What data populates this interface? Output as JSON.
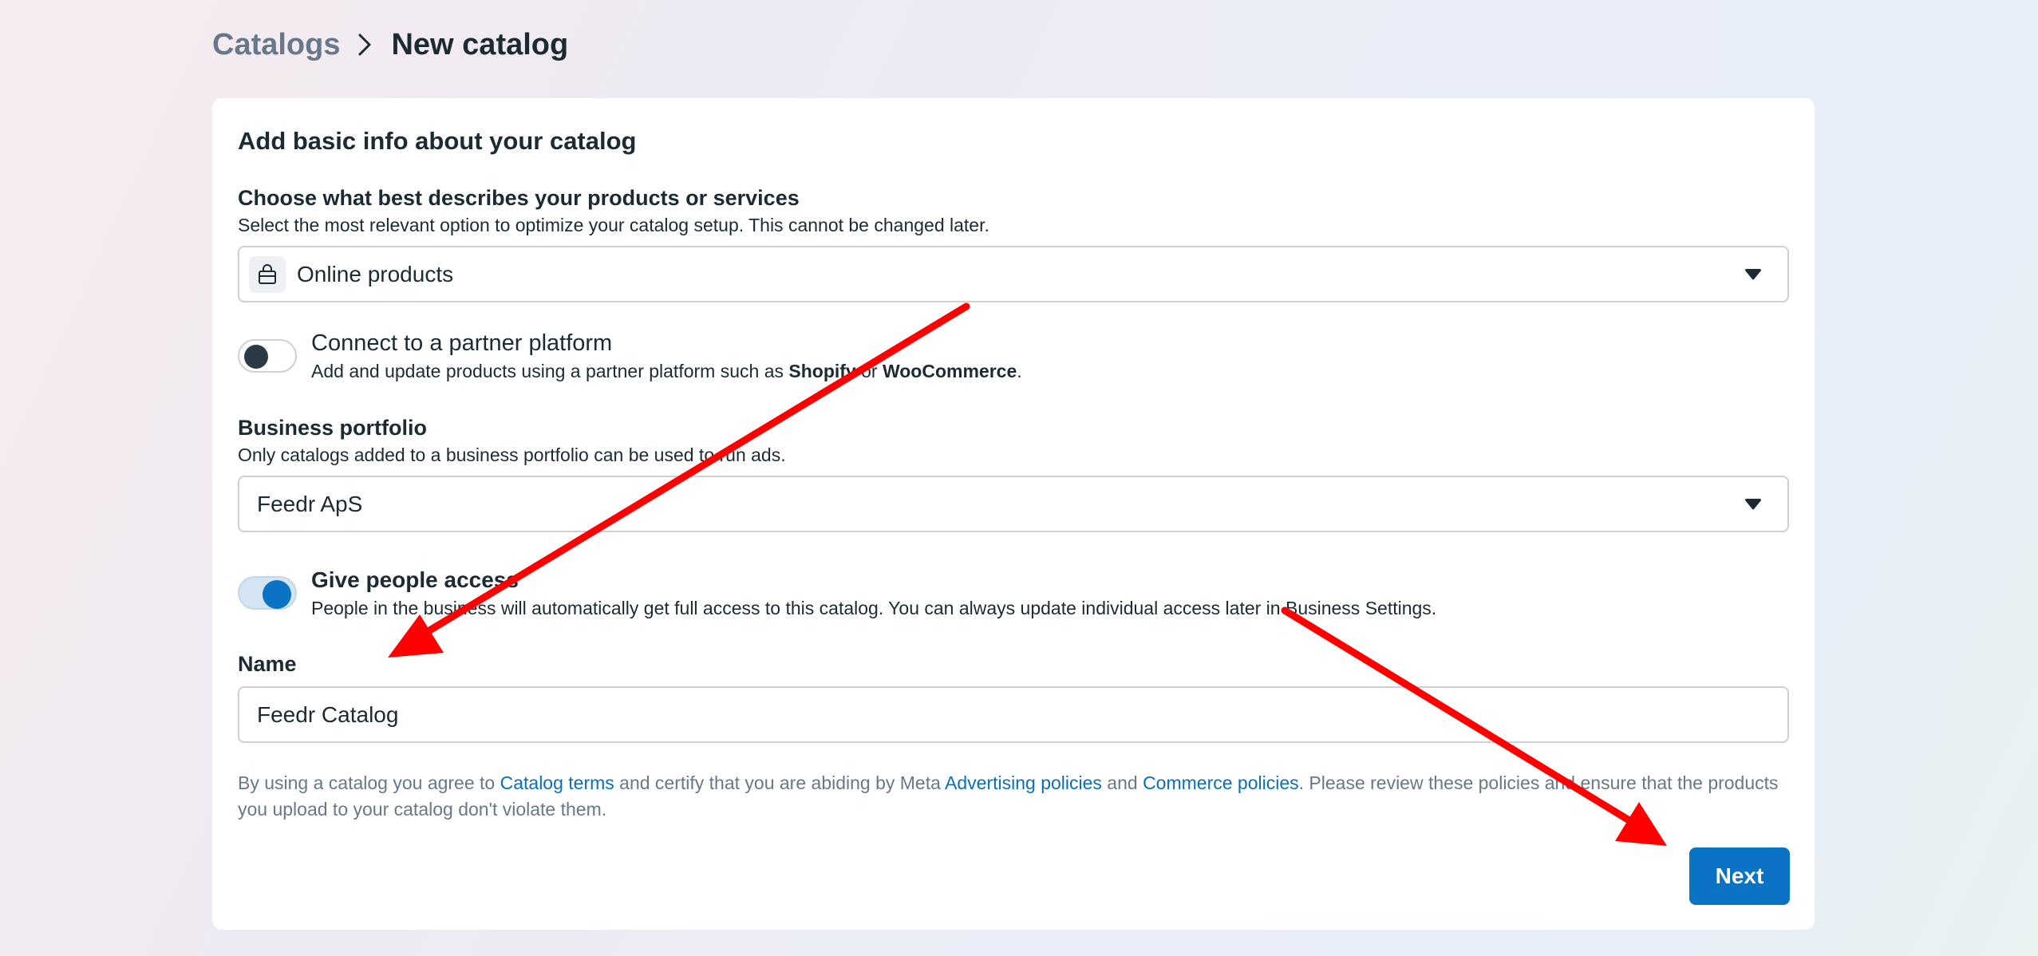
{
  "breadcrumb": {
    "parent": "Catalogs",
    "current": "New catalog"
  },
  "card": {
    "title": "Add basic info about your catalog",
    "product_type": {
      "label": "Choose what best describes your products or services",
      "help": "Select the most relevant option to optimize your catalog setup. This cannot be changed later.",
      "value": "Online products",
      "icon": "shopping-bag-icon"
    },
    "partner": {
      "title": "Connect to a partner platform",
      "desc_prefix": "Add and update products using a partner platform such as ",
      "shopify": "Shopify",
      "or": " or ",
      "woocommerce": "WooCommerce",
      "period": ".",
      "enabled": false
    },
    "portfolio": {
      "label": "Business portfolio",
      "help": "Only catalogs added to a business portfolio can be used to run ads.",
      "value": "Feedr ApS"
    },
    "access": {
      "title": "Give people access",
      "desc": "People in the business will automatically get full access to this catalog. You can always update individual access later in Business Settings.",
      "enabled": true
    },
    "name": {
      "label": "Name",
      "value": "Feedr Catalog"
    },
    "terms": {
      "p1": "By using a catalog you agree to ",
      "catalog_terms": "Catalog terms",
      "p2": " and certify that you are abiding by Meta ",
      "advertising": "Advertising policies",
      "p3": " and ",
      "commerce": "Commerce policies",
      "p4": ". Please review these policies and ensure that the products you upload to your catalog don't violate them."
    },
    "next_label": "Next"
  },
  "colors": {
    "primary": "#0a73c3",
    "link": "#0a6fb8",
    "annotation_arrow": "#ff0000"
  }
}
